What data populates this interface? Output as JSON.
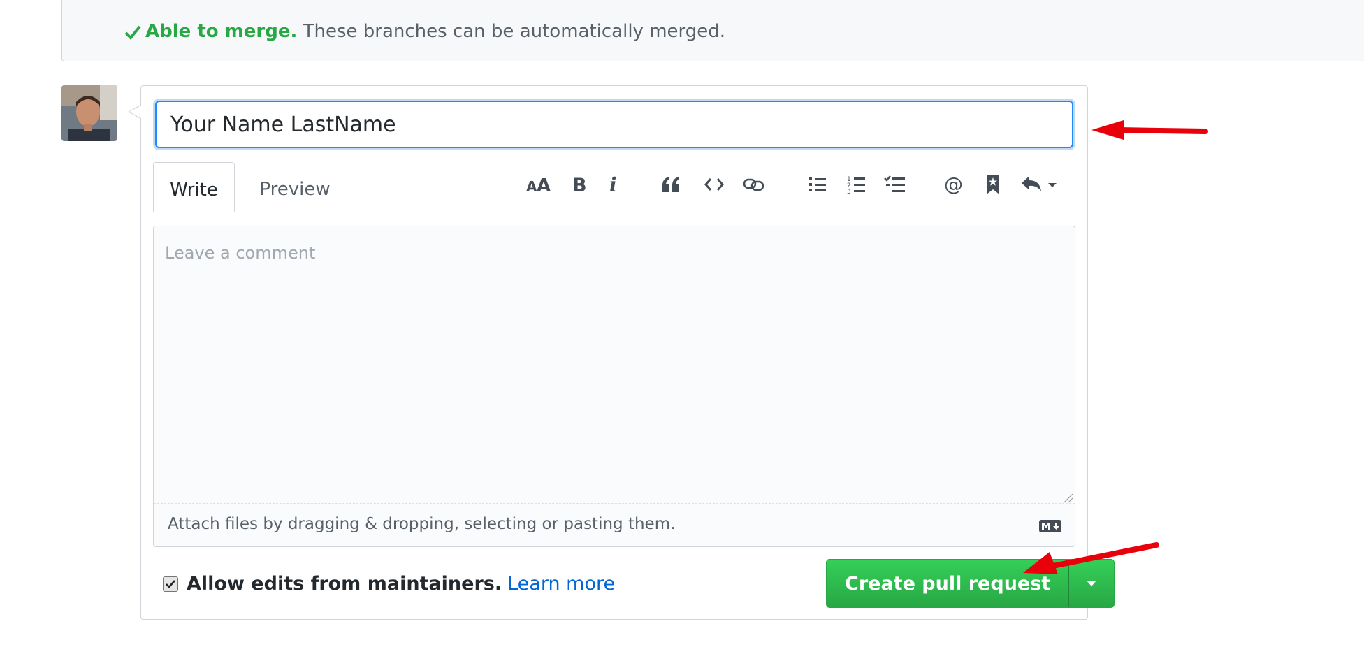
{
  "merge_status": {
    "headline": "Able to merge.",
    "detail": "These branches can be automatically merged.",
    "color": "#28a745"
  },
  "comment_form": {
    "title_value": "Your Name LastName",
    "tabs": {
      "write": "Write",
      "preview": "Preview"
    },
    "toolbar_icons": [
      "text-size-icon",
      "bold-icon",
      "italic-icon",
      "quote-icon",
      "code-icon",
      "link-icon",
      "bulleted-list-icon",
      "numbered-list-icon",
      "task-list-icon",
      "mention-icon",
      "reference-icon",
      "reply-icon"
    ],
    "comment_placeholder": "Leave a comment",
    "attach_hint": "Attach files by dragging & dropping, selecting or pasting them.",
    "allow_edits_label": "Allow edits from maintainers.",
    "allow_edits_checked": true,
    "learn_more": "Learn more",
    "submit_label": "Create pull request",
    "accent_color": "#28a745",
    "link_color": "#0366d6"
  },
  "annotation_color": "#e8000b"
}
